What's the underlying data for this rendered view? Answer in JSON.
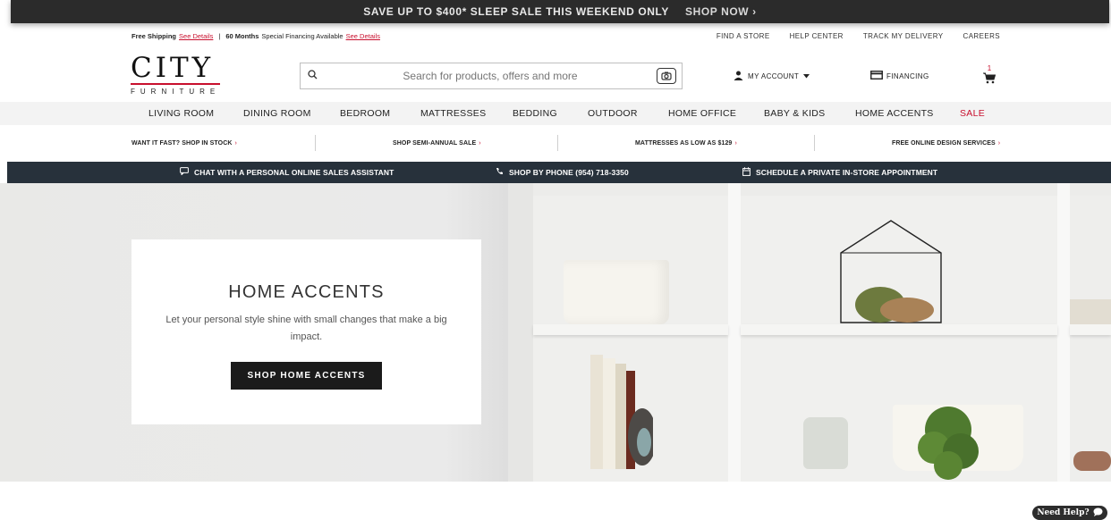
{
  "promo": {
    "text": "SAVE UP TO $400* SLEEP SALE THIS WEEKEND ONLY",
    "cta": "SHOP NOW ›"
  },
  "utility": {
    "shipping_bold": "Free Shipping",
    "shipping_link": "See Details",
    "separator": "|",
    "financing_bold": "60 Months",
    "financing_text": "Special Financing Available",
    "financing_link": "See Details",
    "links": [
      "FIND A STORE",
      "HELP CENTER",
      "TRACK MY DELIVERY",
      "CAREERS"
    ]
  },
  "header": {
    "logo_main": "CITY",
    "logo_sub": "FURNITURE",
    "search_placeholder": "Search for products, offers and more",
    "account_label": "MY ACCOUNT",
    "financing_label": "FINANCING",
    "cart_count": "1"
  },
  "nav": {
    "items": [
      "LIVING ROOM",
      "DINING ROOM",
      "BEDROOM",
      "MATTRESSES",
      "BEDDING",
      "OUTDOOR",
      "HOME OFFICE",
      "BABY & KIDS",
      "HOME ACCENTS",
      "SALE"
    ]
  },
  "sub": {
    "items": [
      "WANT IT FAST? SHOP IN STOCK",
      "SHOP SEMI-ANNUAL SALE",
      "MATTRESSES AS LOW AS $129",
      "FREE ONLINE DESIGN SERVICES"
    ],
    "chevron": "›"
  },
  "services": {
    "items": [
      "CHAT WITH A PERSONAL ONLINE SALES ASSISTANT",
      "SHOP BY PHONE (954) 718-3350",
      "SCHEDULE A PRIVATE IN-STORE APPOINTMENT"
    ]
  },
  "hero": {
    "title": "HOME ACCENTS",
    "body": "Let your personal style shine with small changes that make a big impact.",
    "cta": "SHOP HOME ACCENTS"
  },
  "help": {
    "label": "Need Help?"
  },
  "colors": {
    "accent": "#c8102e",
    "dark_bar": "#27313b",
    "nav_bg": "#f3f3f3"
  }
}
